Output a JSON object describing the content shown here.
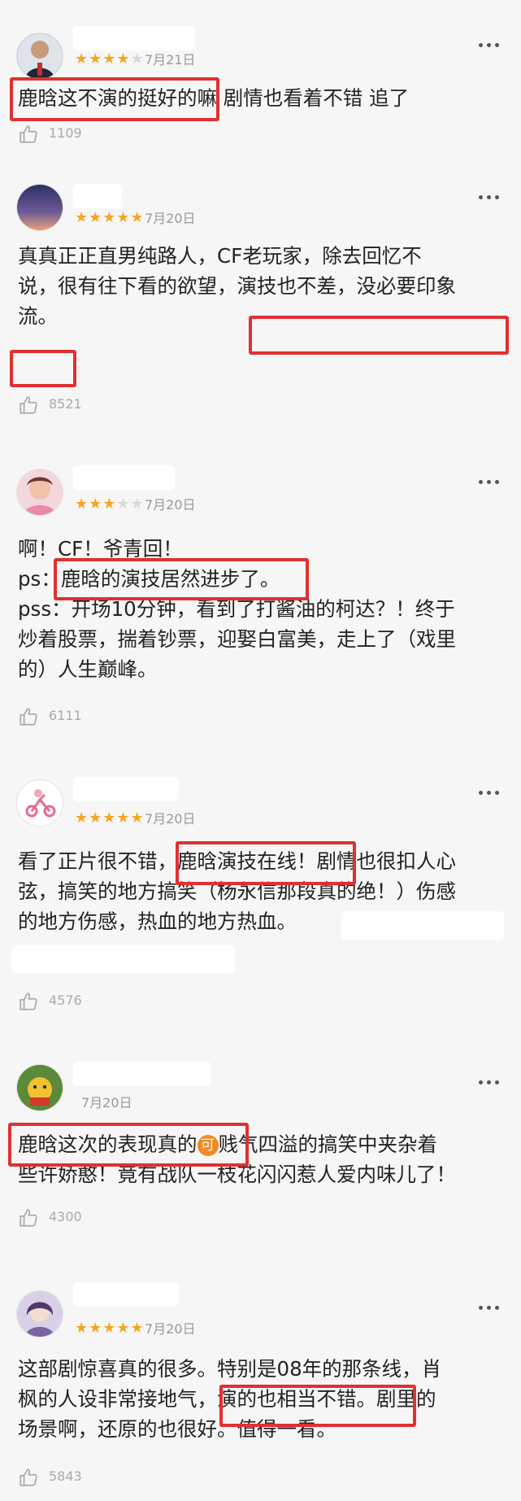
{
  "reviews": [
    {
      "date": "7月21日",
      "rating": 4,
      "text": [
        "鹿晗这不演的挺好的嘛 剧情也看着不错 追了"
      ],
      "likes": "1109"
    },
    {
      "date": "7月20日",
      "rating": 5,
      "text": [
        "真真正正直男纯路人，CF老玩家，除去回忆不",
        "说，很有往下看的欲望，演技也不差，没必要印象",
        "流。"
      ],
      "likes": "8521"
    },
    {
      "date": "7月20日",
      "rating": 3,
      "text": [
        "啊！CF！爷青回！",
        "ps：鹿晗的演技居然进步了。",
        "pss：开场10分钟，看到了打酱油的柯达？！终于",
        "炒着股票，揣着钞票，迎娶白富美，走上了（戏里",
        "的）人生巅峰。"
      ],
      "likes": "6111"
    },
    {
      "date": "7月20日",
      "rating": 5,
      "text": [
        "看了正片很不错，鹿晗演技在线！剧情也很扣人心",
        "弦，搞笑的地方搞笑（杨永信那段真的绝！）伤感",
        "的地方伤感，热血的地方热血。"
      ],
      "likes": "4576"
    },
    {
      "date": "7月20日",
      "rating": 0,
      "text_prefix": "鹿晗这次的表现真的",
      "emoji": "可",
      "text_suffix": "贱气四溢的搞笑中夹杂着",
      "text": [
        "些许娇憨！竟有战队一枝花闪闪惹人爱内味儿了！"
      ],
      "likes": "4300"
    },
    {
      "date": "7月20日",
      "rating": 5,
      "text": [
        "这部剧惊喜真的很多。特别是08年的那条线，肖",
        "枫的人设非常接地气，演的也相当不错。剧里的",
        "场景啊，还原的也很好。值得一看。"
      ],
      "likes": "5843"
    }
  ]
}
